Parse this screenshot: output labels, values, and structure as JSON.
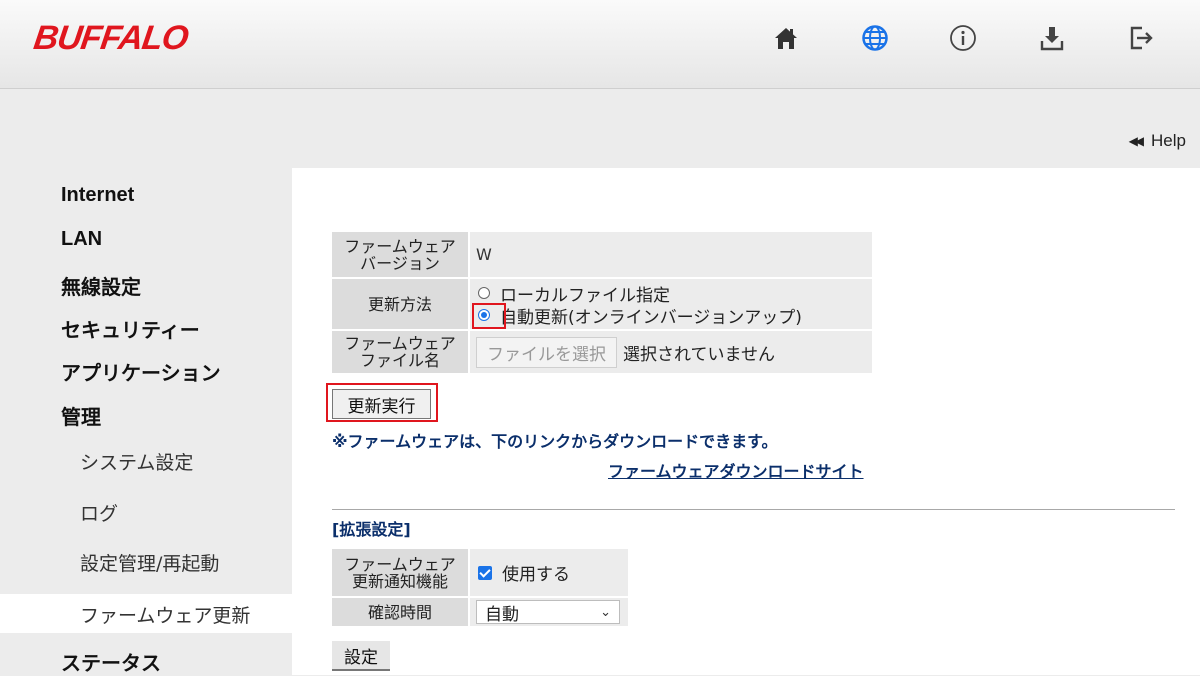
{
  "header": {
    "logo": "BUFFALO",
    "icons": [
      "home-icon",
      "globe-icon",
      "info-icon",
      "download-icon",
      "logout-icon"
    ],
    "accent": "#e0161e"
  },
  "help": {
    "label": "Help"
  },
  "sidebar": {
    "items": [
      {
        "label": "Internet"
      },
      {
        "label": "LAN"
      },
      {
        "label": "無線設定"
      },
      {
        "label": "セキュリティー"
      },
      {
        "label": "アプリケーション"
      },
      {
        "label": "管理"
      },
      {
        "label": "ステータス"
      }
    ],
    "sub_items": [
      {
        "label": "システム設定"
      },
      {
        "label": "ログ"
      },
      {
        "label": "設定管理/再起動"
      },
      {
        "label": "ファームウェア更新"
      }
    ],
    "active": "ファームウェア更新"
  },
  "firmware": {
    "version_label_1": "ファームウェア",
    "version_label_2": "バージョン",
    "version_value": "W",
    "method_label": "更新方法",
    "method_local": "ローカルファイル指定",
    "method_auto": "自動更新(オンラインバージョンアップ)",
    "method_selected": "auto",
    "file_label_1": "ファームウェア",
    "file_label_2": "ファイル名",
    "file_button": "ファイルを選択",
    "file_status": "選択されていません",
    "update_button": "更新実行",
    "note": "※ファームウェアは、下のリンクからダウンロードできます。",
    "download_link": "ファームウェアダウンロードサイト"
  },
  "extended": {
    "title": "[拡張設定]",
    "notify_label_1": "ファームウェア",
    "notify_label_2": "更新通知機能",
    "notify_checkbox": "使用する",
    "notify_checked": true,
    "time_label": "確認時間",
    "time_value": "自動",
    "set_button": "設定"
  },
  "colors": {
    "link": "#0b2f6b",
    "highlight": "#e0161e",
    "checkbox": "#1a73e8"
  }
}
